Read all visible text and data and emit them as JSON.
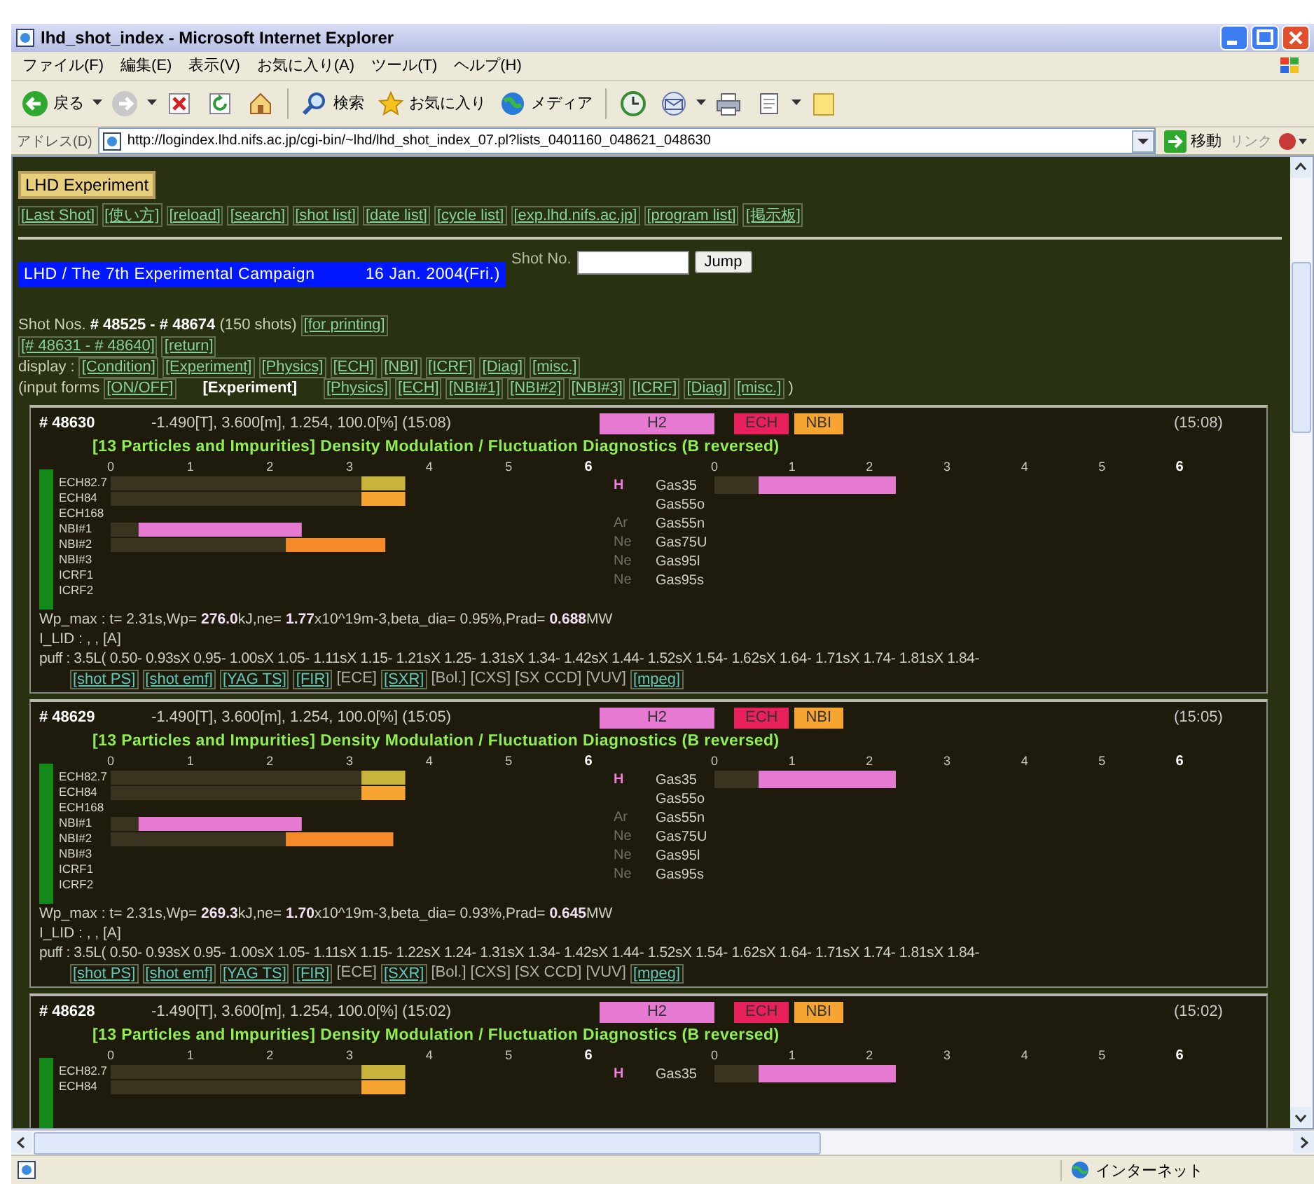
{
  "window": {
    "title": "lhd_shot_index - Microsoft Internet Explorer"
  },
  "menu": [
    "ファイル(F)",
    "編集(E)",
    "表示(V)",
    "お気に入り(A)",
    "ツール(T)",
    "ヘルプ(H)"
  ],
  "toolbar": [
    {
      "kind": "back",
      "label": "戻る",
      "dropdown": true
    },
    {
      "kind": "forward",
      "dropdown": true
    },
    {
      "kind": "stop",
      "dropdown": false
    },
    {
      "kind": "refresh",
      "dropdown": false
    },
    {
      "kind": "home",
      "dropdown": false
    },
    {
      "kind": "search",
      "label": "検索",
      "dropdown": false
    },
    {
      "kind": "favorites",
      "label": "お気に入り",
      "dropdown": false
    },
    {
      "kind": "media",
      "label": "メディア",
      "dropdown": false
    },
    {
      "kind": "history",
      "dropdown": false
    },
    {
      "kind": "mail",
      "dropdown": true
    },
    {
      "kind": "print",
      "dropdown": false
    },
    {
      "kind": "edit",
      "dropdown": true
    },
    {
      "kind": "note",
      "dropdown": false
    }
  ],
  "address": {
    "label": "アドレス(D)",
    "url": "http://logindex.lhd.nifs.ac.jp/cgi-bin/~lhd/lhd_shot_index_07.pl?lists_0401160_048621_048630",
    "go": "移動",
    "links": "リンク"
  },
  "page": {
    "badge": "LHD Experiment",
    "nav": [
      "[Last Shot]",
      "[使い方]",
      "[reload]",
      "[search]",
      "[shot list]",
      "[date list]",
      "[cycle list]",
      "[exp.lhd.nifs.ac.jp]",
      "[program list]",
      "[掲示板]"
    ],
    "campaign": {
      "title": "LHD / The 7th Experimental Campaign",
      "date": "16 Jan. 2004(Fri.)"
    },
    "shot_field": {
      "label": "Shot No.",
      "button": "Jump"
    },
    "shot_range": "Shot Nos. **# 48525 - # 48674** (150 shots)",
    "printing": "[for printing]",
    "subrange": [
      "[# 48631 - # 48640]",
      "[return]"
    ],
    "display": {
      "label": "display :",
      "links": [
        "[Condition]",
        "[Experiment]",
        "[Physics]",
        "[ECH]",
        "[NBI]",
        "[ICRF]",
        "[Diag]",
        "[misc.]"
      ]
    },
    "input_forms": {
      "label": "(input forms",
      "toggle": "[ON/OFF]",
      "items": [
        {
          "label": "[Experiment]",
          "selected": true
        },
        {
          "label": "[Physics]",
          "selected": false
        },
        {
          "label": "[ECH]",
          "selected": false
        },
        {
          "label": "[NBI#1]",
          "selected": false
        },
        {
          "label": "[NBI#2]",
          "selected": false
        },
        {
          "label": "[NBI#3]",
          "selected": false
        },
        {
          "label": "[ICRF]",
          "selected": false
        },
        {
          "label": "[Diag]",
          "selected": false
        },
        {
          "label": "[misc.]",
          "selected": false
        }
      ],
      "close": ")"
    }
  },
  "shots": [
    {
      "number": "# 48630",
      "params": "-1.490[T], 3.600[m], 1.254, 100.0[%] (15:08)",
      "tags": [
        {
          "label": "H2",
          "color": "#e67ad2"
        },
        {
          "label": "ECH",
          "color": "#e8205c"
        },
        {
          "label": "NBI",
          "color": "#f6a630"
        }
      ],
      "time": "(15:08)",
      "title": "[13 Particles and Impurities] Density Modulation / Fluctuation Diagnostics (B reversed)",
      "chart_data": {
        "type": "bar",
        "orientation": "horizontal",
        "stacked": true,
        "categories": [
          "ECH82.7",
          "ECH84",
          "ECH168",
          "NBI#1",
          "NBI#2",
          "NBI#3",
          "ICRF1",
          "ICRF2"
        ],
        "xlim": [
          0,
          6
        ],
        "xticks": [
          0,
          1,
          2,
          3,
          4,
          5,
          6
        ],
        "series": [
          {
            "color": "#3a3320",
            "values": [
              3.15,
              3.15,
              null,
              0.35,
              2.2,
              null,
              null,
              null
            ]
          },
          {
            "values": [
              0.55,
              0.55,
              null,
              2.05,
              1.25,
              null,
              null,
              null
            ],
            "colors": [
              "#c8b43a",
              "#f6a630",
              null,
              "#e67ad2",
              "#f58a2a",
              null,
              null,
              null
            ]
          }
        ]
      },
      "gas": {
        "rows": [
          {
            "species": "H",
            "active": true
          },
          {},
          {
            "species": "Ar",
            "active": false
          },
          {
            "species": "Ne",
            "active": false
          },
          {
            "species": "Ne",
            "active": false
          },
          {
            "species": "Ne",
            "active": false
          }
        ],
        "chart_data": {
          "type": "bar",
          "orientation": "horizontal",
          "stacked": true,
          "categories": [
            "Gas35",
            "Gas55o",
            "Gas55n",
            "Gas75U",
            "Gas95l",
            "Gas95s"
          ],
          "xlim": [
            0,
            6
          ],
          "xticks": [
            0,
            1,
            2,
            3,
            4,
            5,
            6
          ],
          "series": [
            {
              "color": "#3a3320",
              "values": [
                0.57,
                null,
                null,
                null,
                null,
                null
              ]
            },
            {
              "values": [
                1.77,
                null,
                null,
                null,
                null,
                null
              ],
              "colors": [
                "#e67ad2",
                null,
                null,
                null,
                null,
                null
              ]
            }
          ]
        }
      },
      "wp": "Wp_max : t= 2.31s,Wp= **276.0**kJ,ne= **1.77**x10^19m-3,beta_dia= 0.95%,Prad= **0.688**MW",
      "lid": "I_LID : , , [A]",
      "puff": "puff : 3.5L( 0.50- 0.93sX 0.95- 1.00sX 1.05- 1.11sX 1.15- 1.21sX 1.25- 1.31sX 1.34- 1.42sX 1.44- 1.52sX 1.54- 1.62sX 1.64- 1.71sX 1.74- 1.81sX 1.84-",
      "links": [
        {
          "label": "[shot PS]",
          "kind": "link"
        },
        {
          "label": "[shot emf]",
          "kind": "link"
        },
        {
          "label": "[YAG TS]",
          "kind": "link"
        },
        {
          "label": "[FIR]",
          "kind": "link"
        },
        {
          "label": "[ECE]",
          "kind": "plain"
        },
        {
          "label": "[SXR]",
          "kind": "link"
        },
        {
          "label": "[Bol.]",
          "kind": "plain"
        },
        {
          "label": "[CXS]",
          "kind": "plain"
        },
        {
          "label": "[SX CCD]",
          "kind": "plain"
        },
        {
          "label": "[VUV]",
          "kind": "plain"
        },
        {
          "label": "[mpeg]",
          "kind": "link"
        }
      ]
    },
    {
      "number": "# 48629",
      "params": "-1.490[T], 3.600[m], 1.254, 100.0[%] (15:05)",
      "tags": [
        {
          "label": "H2",
          "color": "#e67ad2"
        },
        {
          "label": "ECH",
          "color": "#e8205c"
        },
        {
          "label": "NBI",
          "color": "#f6a630"
        }
      ],
      "time": "(15:05)",
      "title": "[13 Particles and Impurities] Density Modulation / Fluctuation Diagnostics (B reversed)",
      "chart_data": {
        "type": "bar",
        "orientation": "horizontal",
        "stacked": true,
        "categories": [
          "ECH82.7",
          "ECH84",
          "ECH168",
          "NBI#1",
          "NBI#2",
          "NBI#3",
          "ICRF1",
          "ICRF2"
        ],
        "xlim": [
          0,
          6
        ],
        "xticks": [
          0,
          1,
          2,
          3,
          4,
          5,
          6
        ],
        "series": [
          {
            "color": "#3a3320",
            "values": [
              3.15,
              3.15,
              null,
              0.35,
              2.2,
              null,
              null,
              null
            ]
          },
          {
            "values": [
              0.55,
              0.55,
              null,
              2.05,
              1.35,
              null,
              null,
              null
            ],
            "colors": [
              "#c8b43a",
              "#f6a630",
              null,
              "#e67ad2",
              "#f58a2a",
              null,
              null,
              null
            ]
          }
        ]
      },
      "gas": {
        "rows": [
          {
            "species": "H",
            "active": true
          },
          {},
          {
            "species": "Ar",
            "active": false
          },
          {
            "species": "Ne",
            "active": false
          },
          {
            "species": "Ne",
            "active": false
          },
          {
            "species": "Ne",
            "active": false
          }
        ],
        "chart_data": {
          "type": "bar",
          "orientation": "horizontal",
          "stacked": true,
          "categories": [
            "Gas35",
            "Gas55o",
            "Gas55n",
            "Gas75U",
            "Gas95l",
            "Gas95s"
          ],
          "xlim": [
            0,
            6
          ],
          "xticks": [
            0,
            1,
            2,
            3,
            4,
            5,
            6
          ],
          "series": [
            {
              "color": "#3a3320",
              "values": [
                0.57,
                null,
                null,
                null,
                null,
                null
              ]
            },
            {
              "values": [
                1.77,
                null,
                null,
                null,
                null,
                null
              ],
              "colors": [
                "#e67ad2",
                null,
                null,
                null,
                null,
                null
              ]
            }
          ]
        }
      },
      "wp": "Wp_max : t= 2.31s,Wp= **269.3**kJ,ne= **1.70**x10^19m-3,beta_dia= 0.93%,Prad= **0.645**MW",
      "lid": "I_LID : , , [A]",
      "puff": "puff : 3.5L( 0.50- 0.93sX 0.95- 1.00sX 1.05- 1.11sX 1.15- 1.22sX 1.24- 1.31sX 1.34- 1.42sX 1.44- 1.52sX 1.54- 1.62sX 1.64- 1.71sX 1.74- 1.81sX 1.84-",
      "links": [
        {
          "label": "[shot PS]",
          "kind": "link"
        },
        {
          "label": "[shot emf]",
          "kind": "link"
        },
        {
          "label": "[YAG TS]",
          "kind": "link"
        },
        {
          "label": "[FIR]",
          "kind": "link"
        },
        {
          "label": "[ECE]",
          "kind": "plain"
        },
        {
          "label": "[SXR]",
          "kind": "link"
        },
        {
          "label": "[Bol.]",
          "kind": "plain"
        },
        {
          "label": "[CXS]",
          "kind": "plain"
        },
        {
          "label": "[SX CCD]",
          "kind": "plain"
        },
        {
          "label": "[VUV]",
          "kind": "plain"
        },
        {
          "label": "[mpeg]",
          "kind": "link"
        }
      ]
    },
    {
      "number": "# 48628",
      "params": "-1.490[T], 3.600[m], 1.254, 100.0[%] (15:02)",
      "tags": [
        {
          "label": "H2",
          "color": "#e67ad2"
        },
        {
          "label": "ECH",
          "color": "#e8205c"
        },
        {
          "label": "NBI",
          "color": "#f6a630"
        }
      ],
      "time": "(15:02)",
      "title": "[13 Particles and Impurities] Density Modulation / Fluctuation Diagnostics (B reversed)",
      "chart_data": {
        "type": "bar",
        "orientation": "horizontal",
        "stacked": true,
        "categories": [
          "ECH82.7",
          "ECH84"
        ],
        "xlim": [
          0,
          6
        ],
        "xticks": [
          0,
          1,
          2,
          3,
          4,
          5,
          6
        ],
        "series": [
          {
            "color": "#3a3320",
            "values": [
              3.15,
              3.15
            ]
          },
          {
            "values": [
              0.55,
              0.55
            ],
            "colors": [
              "#c8b43a",
              "#f6a630"
            ]
          }
        ]
      },
      "gas": {
        "rows": [
          {
            "species": "H",
            "active": true
          }
        ],
        "chart_data": {
          "type": "bar",
          "orientation": "horizontal",
          "stacked": true,
          "categories": [
            "Gas35"
          ],
          "xlim": [
            0,
            6
          ],
          "xticks": [
            0,
            1,
            2,
            3,
            4,
            5,
            6
          ],
          "series": [
            {
              "color": "#3a3320",
              "values": [
                0.57
              ]
            },
            {
              "values": [
                1.77
              ],
              "colors": [
                "#e67ad2"
              ]
            }
          ]
        }
      }
    }
  ],
  "status_bar": {
    "zone": "インターネット"
  }
}
